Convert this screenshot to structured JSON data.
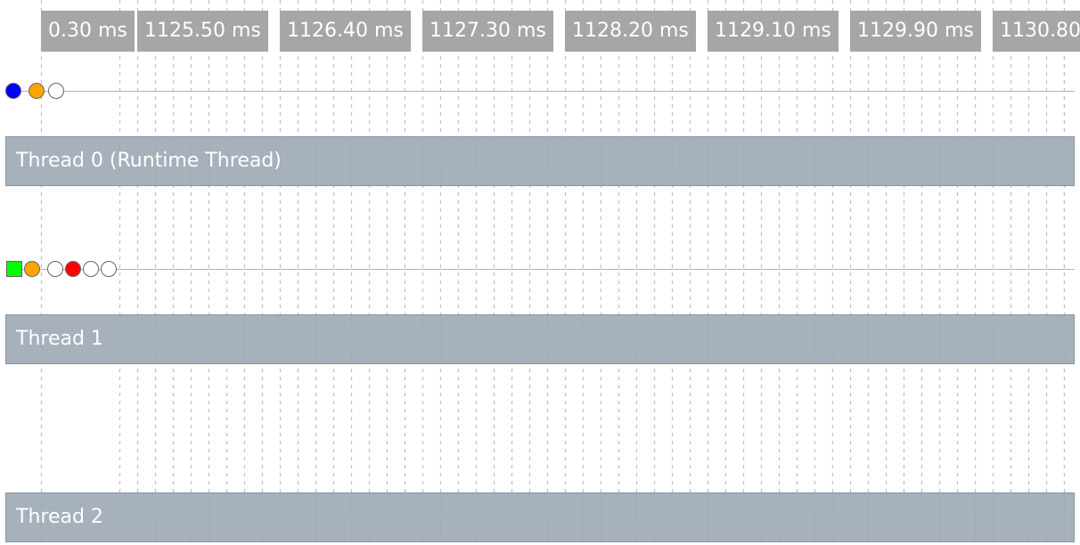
{
  "time_axis": {
    "ticks": [
      "0.30 ms",
      "1125.50 ms",
      "1126.40 ms",
      "1127.30 ms",
      "1128.20 ms",
      "1129.10 ms",
      "1129.90 ms",
      "1130.80"
    ],
    "label_bg_color": "#a6a6a6",
    "grid_color": "#c2c2c2"
  },
  "threads": [
    {
      "name": "Thread 0 (Runtime Thread)",
      "markers": [
        {
          "shape": "circle",
          "color": "#0000ff"
        },
        {
          "shape": "circle",
          "color": "#ffa500"
        },
        {
          "shape": "circle",
          "color": "#ffffff"
        }
      ]
    },
    {
      "name": "Thread 1",
      "markers": [
        {
          "shape": "square",
          "color": "#00ff00"
        },
        {
          "shape": "circle",
          "color": "#ffa500"
        },
        {
          "shape": "circle",
          "color": "#ffffff"
        },
        {
          "shape": "circle",
          "color": "#ff0000"
        },
        {
          "shape": "circle",
          "color": "#ffffff"
        },
        {
          "shape": "circle",
          "color": "#ffffff"
        }
      ]
    },
    {
      "name": "Thread 2",
      "markers": []
    }
  ],
  "colors": {
    "thread_bar": "#96a3b0",
    "baseline": "#b3b3b3"
  }
}
